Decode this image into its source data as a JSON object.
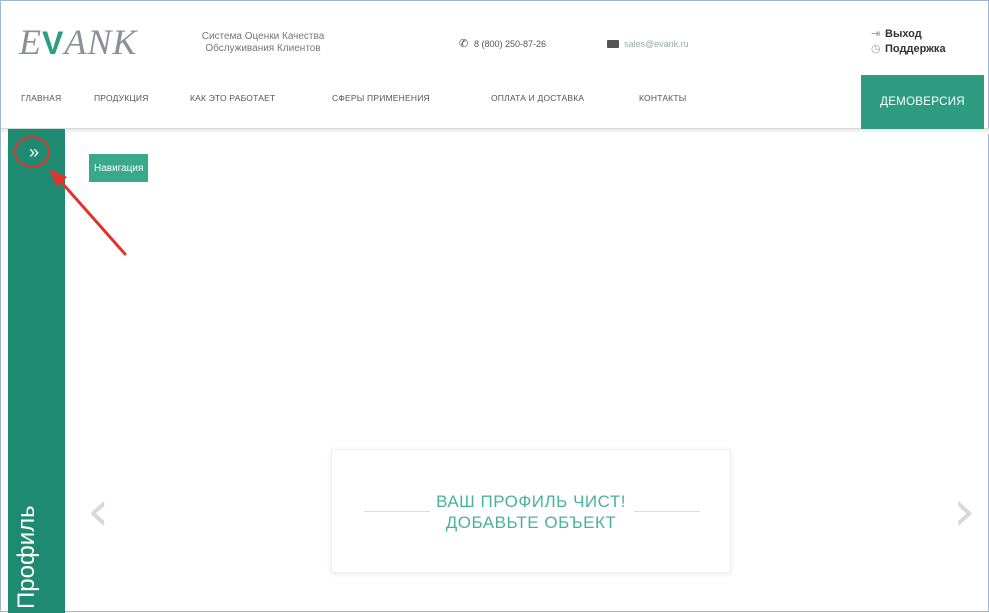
{
  "header": {
    "logo_left": "E",
    "logo_mark": "V",
    "logo_right": "ANK",
    "tagline_line1": "Система Оценки Качества",
    "tagline_line2": "Обслуживания Клиентов",
    "phone": "8 (800) 250-87-26",
    "email": "sales@evank.ru",
    "logout_label": "Выход",
    "support_label": "Поддержка"
  },
  "nav": {
    "items": [
      "ГЛАВНАЯ",
      "ПРОДУКЦИЯ",
      "КАК ЭТО РАБОТАЕТ",
      "СФЕРЫ ПРИМЕНЕНИЯ",
      "ОПЛАТА И ДОСТАВКА",
      "КОНТАКТЫ"
    ],
    "demo_label": "ДЕМОВЕРСИЯ"
  },
  "sidebar": {
    "toggle_icon": "double-chevron-right-icon",
    "profile_label": "Профиль"
  },
  "main": {
    "nav_tag": "Навигация",
    "empty_line1": "ВАШ ПРОФИЛЬ ЧИСТ!",
    "empty_line2": "ДОБАВЬТЕ ОБЪЕКТ",
    "prev_icon": "chevron-left-icon",
    "next_icon": "chevron-right-icon"
  },
  "colors": {
    "accent": "#1e8a72",
    "accent_light": "#39a88b",
    "annotation": "#e0342b"
  }
}
